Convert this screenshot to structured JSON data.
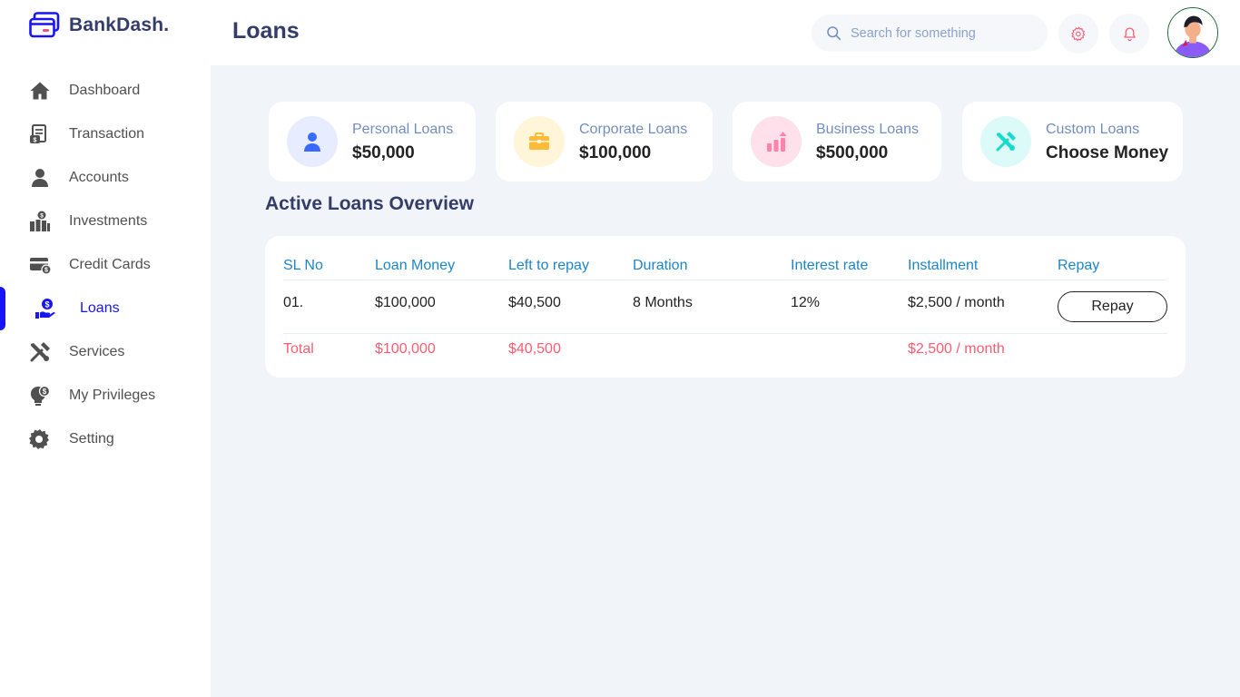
{
  "brand": {
    "name": "BankDash."
  },
  "sidebar": {
    "items": [
      {
        "label": "Dashboard",
        "icon": "home-icon",
        "active": false
      },
      {
        "label": "Transaction",
        "icon": "transaction-icon",
        "active": false
      },
      {
        "label": "Accounts",
        "icon": "user-icon",
        "active": false
      },
      {
        "label": "Investments",
        "icon": "investment-icon",
        "active": false
      },
      {
        "label": "Credit Cards",
        "icon": "credit-card-icon",
        "active": false
      },
      {
        "label": "Loans",
        "icon": "loan-icon",
        "active": true
      },
      {
        "label": "Services",
        "icon": "services-icon",
        "active": false
      },
      {
        "label": "My Privileges",
        "icon": "privileges-icon",
        "active": false
      },
      {
        "label": "Setting",
        "icon": "gear-icon",
        "active": false
      }
    ]
  },
  "header": {
    "title": "Loans",
    "search_placeholder": "Search for something"
  },
  "cards": [
    {
      "label": "Personal Loans",
      "value": "$50,000",
      "icon": "person-icon",
      "bg": "#e7edff",
      "fg": "#396aff"
    },
    {
      "label": "Corporate Loans",
      "value": "$100,000",
      "icon": "briefcase-icon",
      "bg": "#fff5d9",
      "fg": "#ffbb38"
    },
    {
      "label": "Business Loans",
      "value": "$500,000",
      "icon": "chart-up-icon",
      "bg": "#ffe0eb",
      "fg": "#ff82ac"
    },
    {
      "label": "Custom Loans",
      "value": "Choose Money",
      "icon": "tools-icon",
      "bg": "#dcfaf8",
      "fg": "#16dbcc"
    }
  ],
  "overview": {
    "title": "Active Loans Overview",
    "columns": [
      "SL No",
      "Loan Money",
      "Left to repay",
      "Duration",
      "Interest rate",
      "Installment",
      "Repay"
    ],
    "rows": [
      {
        "sl": "01.",
        "loan_money": "$100,000",
        "left": "$40,500",
        "duration": "8 Months",
        "rate": "12%",
        "installment": "$2,500 / month",
        "action": "Repay"
      }
    ],
    "total": {
      "label": "Total",
      "loan_money": "$100,000",
      "left": "$40,500",
      "installment": "$2,500 / month"
    }
  },
  "colors": {
    "accent": "#1814f3",
    "title": "#343c6a",
    "header_link": "#1c86c7",
    "total": "#fe5c73",
    "muted": "#718ebf"
  }
}
